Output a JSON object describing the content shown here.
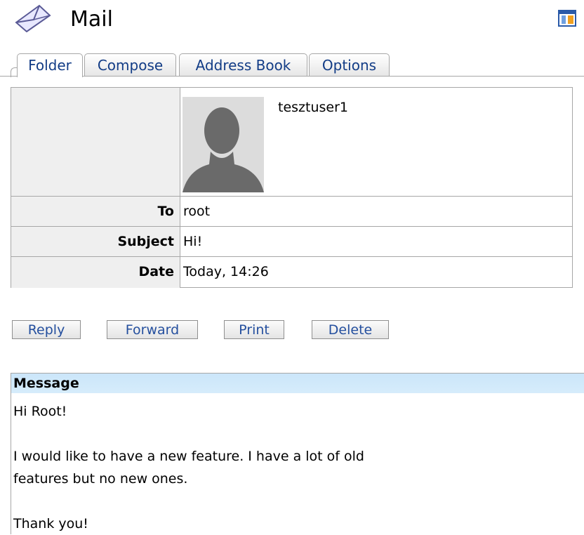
{
  "header": {
    "title": "Mail",
    "mail_icon": "envelope-icon",
    "layout_icon": "layout-toggle-icon"
  },
  "tabs": [
    {
      "label": "Folder",
      "active": true
    },
    {
      "label": "Compose",
      "active": false
    },
    {
      "label": "Address Book",
      "active": false
    },
    {
      "label": "Options",
      "active": false
    }
  ],
  "message_info": {
    "sender": "tesztuser1",
    "to_label": "To",
    "to_value": "root",
    "subject_label": "Subject",
    "subject_value": "Hi!",
    "date_label": "Date",
    "date_value": "Today, 14:26"
  },
  "actions": {
    "reply": "Reply",
    "forward": "Forward",
    "print": "Print",
    "delete": "Delete"
  },
  "message": {
    "header": "Message",
    "body": "Hi Root!\n\nI would like to have a new feature. I have a lot of old\nfeatures but no new ones.\n\nThank you!"
  },
  "colors": {
    "link_blue": "#123c86",
    "message_header_bg": "#cbe6fa",
    "label_bg": "#efefef",
    "border": "#a7a7a7"
  }
}
